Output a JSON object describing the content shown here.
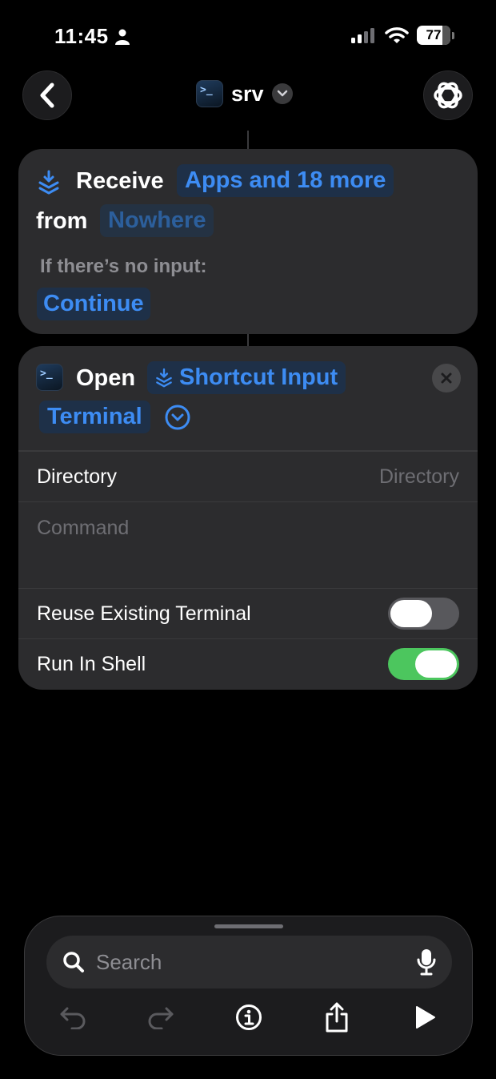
{
  "status_bar": {
    "time": "11:45",
    "battery": "77",
    "battery_level_percent": 77
  },
  "nav": {
    "title": "srv",
    "app_icon_glyph": ">_"
  },
  "receive_card": {
    "verb": "Receive",
    "types_token": "Apps and 18 more",
    "from_label": "from",
    "source_token": "Nowhere",
    "no_input_label": "If there’s no input:",
    "no_input_action": "Continue"
  },
  "open_card": {
    "verb": "Open",
    "input_token": "Shortcut Input",
    "app_token": "Terminal",
    "rows": {
      "directory_label": "Directory",
      "directory_placeholder": "Directory",
      "command_placeholder": "Command",
      "reuse_label": "Reuse Existing Terminal",
      "reuse_on": false,
      "shell_label": "Run In Shell",
      "shell_on": true
    }
  },
  "bottom": {
    "search_placeholder": "Search"
  },
  "colors": {
    "accent": "#3d8cf3",
    "toggle_on": "#4cc65e",
    "card_bg": "#2c2c2e"
  }
}
